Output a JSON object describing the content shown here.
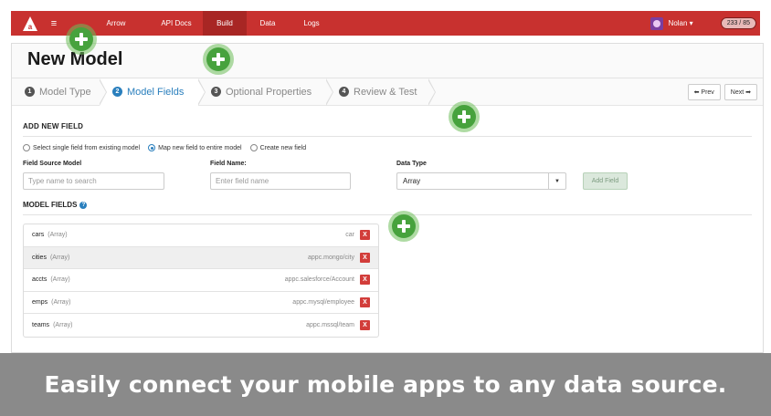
{
  "nav": {
    "items": [
      {
        "label": "Arrow"
      },
      {
        "label": "API Docs"
      },
      {
        "label": "Build"
      },
      {
        "label": "Data"
      },
      {
        "label": "Logs"
      }
    ],
    "active": "Build",
    "user_label": "Nolan ▾",
    "counter": "233 / 85"
  },
  "page": {
    "title": "New Model"
  },
  "steps": [
    {
      "num": "1",
      "label": "Model Type"
    },
    {
      "num": "2",
      "label": "Model Fields"
    },
    {
      "num": "3",
      "label": "Optional Properties"
    },
    {
      "num": "4",
      "label": "Review & Test"
    }
  ],
  "step_buttons": {
    "prev": "⬅ Prev",
    "next": "Next ➡"
  },
  "add_field": {
    "title": "ADD NEW FIELD",
    "radio_options": [
      {
        "label": "Select single field from existing model",
        "selected": false
      },
      {
        "label": "Map new field to entire model",
        "selected": true
      },
      {
        "label": "Create new field",
        "selected": false
      }
    ],
    "source_model_label": "Field Source Model",
    "source_model_placeholder": "Type name to search",
    "field_name_label": "Field Name:",
    "field_name_placeholder": "Enter field name",
    "data_type_label": "Data Type",
    "data_type_value": "Array",
    "add_button": "Add Field"
  },
  "model_fields": {
    "title": "MODEL FIELDS",
    "rows": [
      {
        "name": "cars",
        "type": "(Array)",
        "source": "car"
      },
      {
        "name": "cities",
        "type": "(Array)",
        "source": "appc.mongo/city"
      },
      {
        "name": "accts",
        "type": "(Array)",
        "source": "appc.salesforce/Account"
      },
      {
        "name": "emps",
        "type": "(Array)",
        "source": "appc.mysql/employee"
      },
      {
        "name": "teams",
        "type": "(Array)",
        "source": "appc.mssql/team"
      }
    ],
    "delete_label": "X"
  },
  "banner": {
    "text": "Easily connect your mobile apps to any data source."
  },
  "colors": {
    "nav_red": "#c8312f",
    "accent_blue": "#2a7fbd",
    "delete_red": "#d23d3a",
    "hotspot_green": "#47a23d",
    "banner_gray": "#8a8a8a"
  }
}
